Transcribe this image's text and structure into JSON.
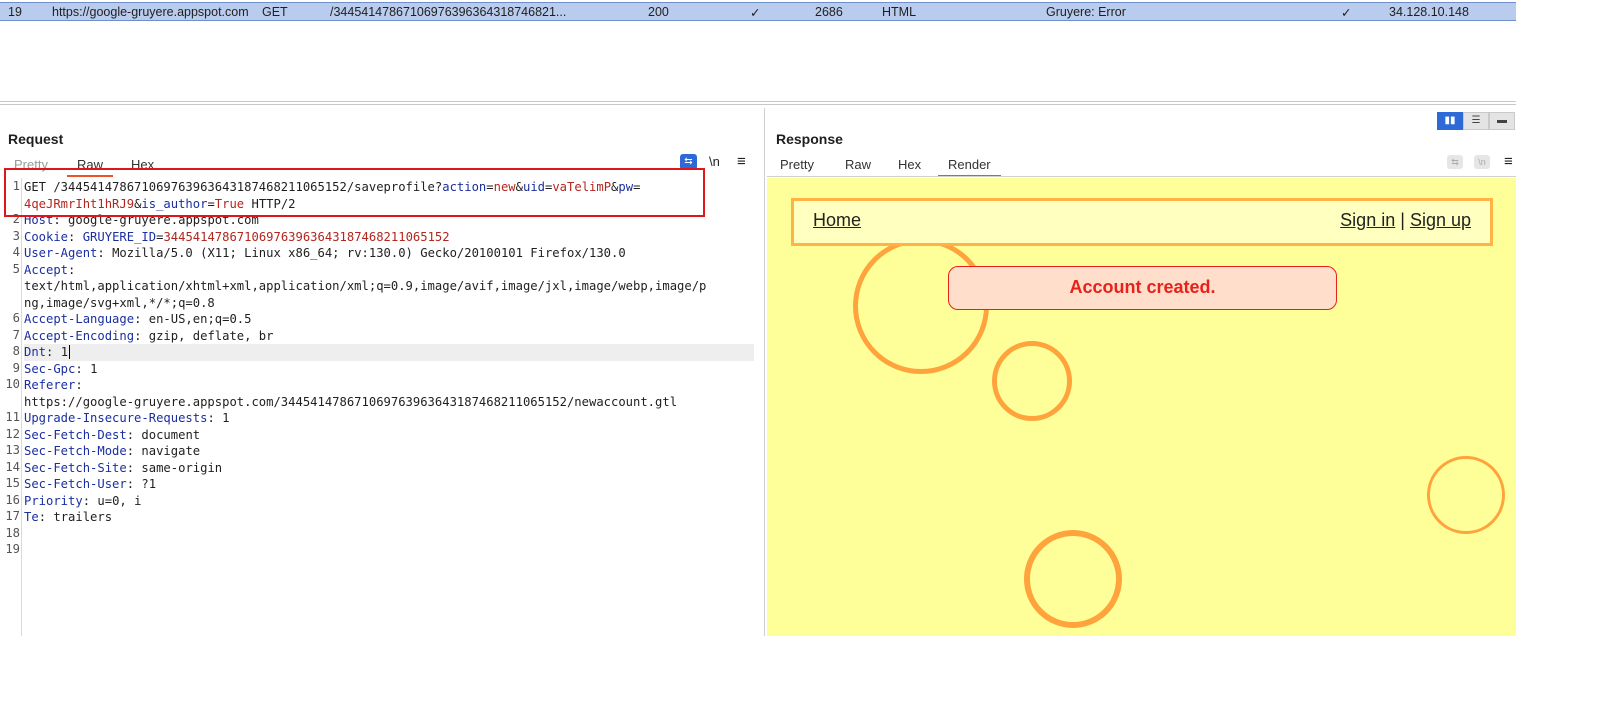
{
  "history_row": {
    "num": "19",
    "host": "https://google-gruyere.appspot.com",
    "method": "GET",
    "path": "/3445414786710697639636431874682​1...",
    "status": "200",
    "params_check": "✓",
    "length": "2686",
    "mime": "HTML",
    "title": "Gruyere: Error",
    "tls_check": "✓",
    "ip": "34.128.10.148"
  },
  "request": {
    "title": "Request",
    "tabs": [
      "Pretty",
      "Raw",
      "Hex"
    ],
    "active_tab": "Raw",
    "icons": {
      "wrap": "wrap-lines-icon",
      "newline": "\\n",
      "menu": "≡"
    },
    "line_numbers": [
      "1",
      "2",
      "3",
      "4",
      "5",
      "",
      "",
      "6",
      "7",
      "8",
      "9",
      "10",
      "",
      "11",
      "12",
      "13",
      "14",
      "15",
      "16",
      "17",
      "18",
      "19"
    ],
    "lines": {
      "l1a_method": "GET /34454147867106976396364318746821106515​2/saveprofile?",
      "l1_action_k": "action",
      "l1_action_v": "new",
      "l1_uid_k": "uid",
      "l1_uid_v": "vaTelimP",
      "l1_pw_k": "pw",
      "l1_pw_v": "4qeJRmrIht1hRJ9",
      "l1_author_k": "is_author",
      "l1_author_v": "True",
      "l1_tail": " HTTP/2",
      "host_k": "Host",
      "host_v": "google-gruyere.appspot.com",
      "cookie_k": "Cookie",
      "cookie_name": "GRUYERE_ID",
      "cookie_v": "34454147867106976396364318746821106515​2",
      "ua_k": "User-Agent",
      "ua_v": "Mozilla/5.0 (X11; Linux x86_64; rv:130.0) Gecko/20100101 Firefox/130.0",
      "accept_k": "Accept",
      "accept_v1": "text/html,application/xhtml+xml,application/xml;q=0.9,image/avif,image/jxl,image/webp,image/p",
      "accept_v2": "ng,image/svg+xml,*/*;q=0.8",
      "lang_k": "Accept-Language",
      "lang_v": "en-US,en;q=0.5",
      "enc_k": "Accept-Encoding",
      "enc_v": "gzip, deflate, br",
      "dnt_k": "Dnt",
      "dnt_v": "1",
      "gpc_k": "Sec-Gpc",
      "gpc_v": "1",
      "ref_k": "Referer",
      "ref_v": "https://google-gruyere.appspot.com/34454147867106976396364318746821106515​2/newaccount.gtl",
      "uir_k": "Upgrade-Insecure-Requests",
      "uir_v": "1",
      "dest_k": "Sec-Fetch-Dest",
      "dest_v": "document",
      "mode_k": "Sec-Fetch-Mode",
      "mode_v": "navigate",
      "site_k": "Sec-Fetch-Site",
      "site_v": "same-origin",
      "user_k": "Sec-Fetch-User",
      "user_v": "?1",
      "prio_k": "Priority",
      "prio_v": "u=0, i",
      "te_k": "Te",
      "te_v": "trailers"
    }
  },
  "response": {
    "title": "Response",
    "tabs": [
      "Pretty",
      "Raw",
      "Hex",
      "Render"
    ],
    "active_tab": "Render",
    "render": {
      "home": "Home",
      "sign_in": "Sign in",
      "divider": "|",
      "sign_up": "Sign up",
      "message": "Account created."
    }
  },
  "colors": {
    "accent": "#e8542c",
    "selection": "#b9ccee",
    "highlight_box": "#e0161b",
    "render_bg": "#ffff99",
    "circle": "#ff9933"
  }
}
